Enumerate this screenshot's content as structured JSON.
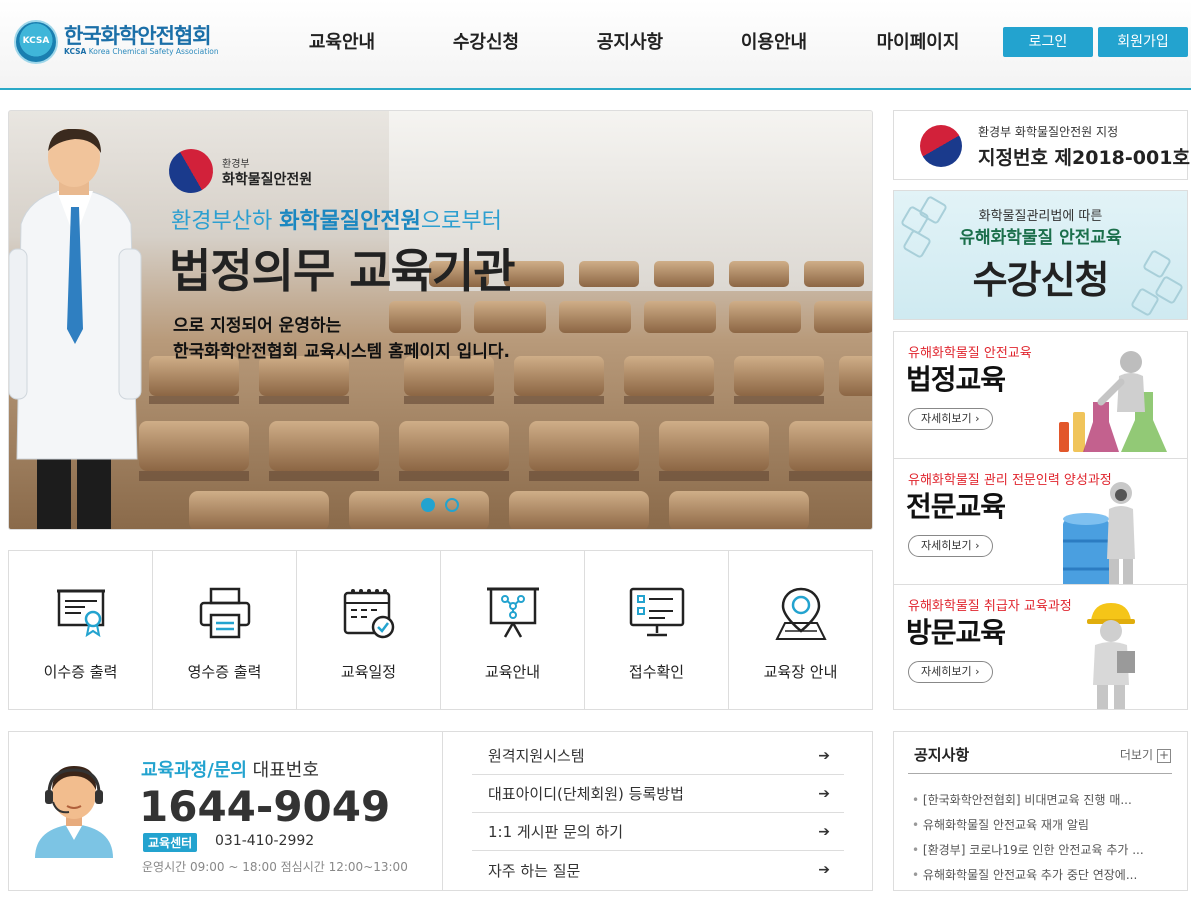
{
  "header": {
    "logo_ko": "한국화학안전협회",
    "logo_en_abbr": "KCSA",
    "logo_en": "Korea Chemical Safety Association",
    "logo_mark": "KCSA",
    "nav": [
      "교육안내",
      "수강신청",
      "공지사항",
      "이용안내",
      "마이페이지"
    ],
    "login_label": "로그인",
    "join_label": "회원가입"
  },
  "hero": {
    "ministry_small": "환경부",
    "ministry_name": "화학물질안전원",
    "line1_pre": "환경부산하 ",
    "line1_bold": "화학물질안전원",
    "line1_post": "으로부터",
    "headline": "법정의무 교육기관",
    "desc1": "으로 지정되어 운영하는",
    "desc2": "한국화학안전협회 교육시스템 홈페이지 입니다.",
    "slides": 2,
    "active_slide": 1
  },
  "quick_menu": [
    {
      "label": "이수증 출력",
      "icon": "certificate-icon"
    },
    {
      "label": "영수증 출력",
      "icon": "printer-icon"
    },
    {
      "label": "교육일정",
      "icon": "calendar-icon"
    },
    {
      "label": "교육안내",
      "icon": "presentation-board-icon"
    },
    {
      "label": "접수확인",
      "icon": "monitor-checklist-icon"
    },
    {
      "label": "교육장 안내",
      "icon": "map-pin-icon"
    }
  ],
  "contact": {
    "title_main": "교육과정/문의",
    "title_sub": " 대표번호",
    "phone": "1644-9049",
    "center_badge": "교육센터",
    "center_phone": "031-410-2992",
    "hours": "운영시간 09:00 ~ 18:00  점심시간 12:00~13:00",
    "links": [
      "원격지원시스템",
      "대표아이디(단체회원) 등록방법",
      "1:1 게시판 문의 하기",
      "자주 하는 질문"
    ],
    "link_arrow": "➔"
  },
  "designation": {
    "line1": "환경부 화학물질안전원 지정",
    "line2": "지정번호 제2018-001호"
  },
  "enroll": {
    "line1": "화학물질관리법에 따른",
    "line2": "유해화학물질 안전교육",
    "line3": "수강신청"
  },
  "courses": [
    {
      "tag": "유해화학물질 안전교육",
      "name": "법정교육",
      "more": "자세히보기 ›"
    },
    {
      "tag": "유해화학물질 관리 전문인력 양성과정",
      "name": "전문교육",
      "more": "자세히보기 ›"
    },
    {
      "tag": "유해화학물질 취급자 교육과정",
      "name": "방문교육",
      "more": "자세히보기 ›"
    }
  ],
  "notice": {
    "title": "공지사항",
    "more_label": "더보기",
    "more_plus": "+",
    "items": [
      "[한국화학안전협회] 비대면교육 진행 매...",
      "유해화학물질 안전교육 재개 알림",
      "[환경부] 코로나19로 인한 안전교육 추가 ...",
      "유해화학물질 안전교육 추가 중단 연장에..."
    ]
  },
  "colors": {
    "accent": "#23a3cf",
    "red_tag": "#e0262f",
    "dark_text": "#222222"
  }
}
